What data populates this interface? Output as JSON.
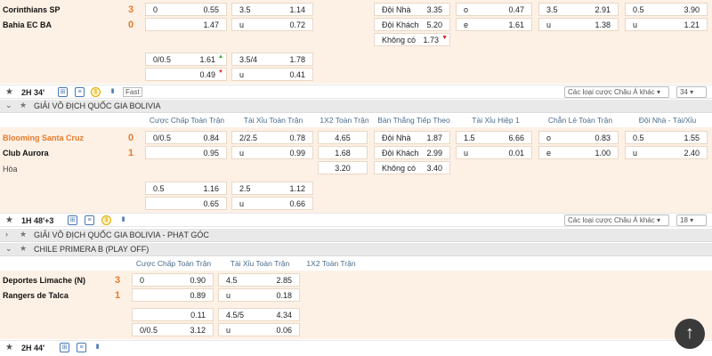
{
  "match1": {
    "home": "Corinthians SP",
    "home_score": "3",
    "away": "Bahia EC BA",
    "away_score": "0",
    "hcap": [
      {
        "line": "0",
        "home": "0.55",
        "ou_line": "3.5",
        "ou": "1.14"
      },
      {
        "line": "",
        "home": "1.47",
        "ou_line": "u",
        "ou": "0.72"
      }
    ],
    "extra": [
      {
        "line": "0/0.5",
        "home": "1.61",
        "ou_line": "3.5/4",
        "ou": "1.78"
      },
      {
        "line": "",
        "home": "0.49",
        "ou_line": "u",
        "ou": "0.41"
      }
    ],
    "next_goal": [
      {
        "label": "Đội Nhà",
        "val": "3.35"
      },
      {
        "label": "Đội Khách",
        "val": "5.20"
      },
      {
        "label": "Không có",
        "val": "1.73"
      }
    ],
    "oe": [
      {
        "l": "o",
        "v": "0.47"
      },
      {
        "l": "e",
        "v": "1.61"
      }
    ],
    "half_ou": [
      {
        "l": "3.5",
        "v": "2.91"
      },
      {
        "l": "u",
        "v": "1.38"
      }
    ],
    "home_ou": [
      {
        "l": "0.5",
        "v": "3.90"
      },
      {
        "l": "u",
        "v": "1.21"
      }
    ]
  },
  "bar1": {
    "time": "2H 34'",
    "fast": "Fast",
    "select": "Các loại cược Châu Á khác",
    "count": "34"
  },
  "league1": "GIẢI VÔ ĐỊCH QUỐC GIA BOLIVIA",
  "headers1": [
    "Cược Chấp Toàn Trận",
    "Tài Xỉu Toàn Trận",
    "1X2 Toàn Trận",
    "Bàn Thắng Tiếp Theo",
    "Tài Xỉu Hiệp 1",
    "Chẵn Lẻ Toàn Trận",
    "Đội Nhà - Tài/Xỉu"
  ],
  "match2": {
    "home": "Blooming Santa Cruz",
    "home_score": "0",
    "away": "Club Aurora",
    "away_score": "1",
    "draw": "Hòa",
    "hcap": [
      {
        "line": "0/0.5",
        "home": "0.84",
        "ou_line": "2/2.5",
        "ou": "0.78",
        "x12": "4.65"
      },
      {
        "line": "",
        "home": "0.95",
        "ou_line": "u",
        "ou": "0.99",
        "x12": "1.68"
      },
      {
        "x12": "3.20"
      }
    ],
    "extra": [
      {
        "line": "0.5",
        "home": "1.16",
        "ou_line": "2.5",
        "ou": "1.12"
      },
      {
        "line": "",
        "home": "0.65",
        "ou_line": "u",
        "ou": "0.66"
      }
    ],
    "next_goal": [
      {
        "label": "Đội Nhà",
        "val": "1.87"
      },
      {
        "label": "Đội Khách",
        "val": "2.99"
      },
      {
        "label": "Không có",
        "val": "3.40"
      }
    ],
    "half_ou": [
      {
        "l": "1.5",
        "v": "6.66"
      },
      {
        "l": "u",
        "v": "0.01"
      }
    ],
    "oe": [
      {
        "l": "o",
        "v": "0.83"
      },
      {
        "l": "e",
        "v": "1.00"
      }
    ],
    "home_ou": [
      {
        "l": "0.5",
        "v": "1.55"
      },
      {
        "l": "u",
        "v": "2.40"
      }
    ]
  },
  "bar2": {
    "time": "1H 48'+3",
    "select": "Các loại cược Châu Á khác",
    "count": "18"
  },
  "league2": "GIẢI VÔ ĐỊCH QUỐC GIA BOLIVIA - PHẠT GÓC",
  "league3": "CHILE PRIMERA B (PLAY OFF)",
  "headers3": [
    "Cược Chấp Toàn Trận",
    "Tài Xỉu Toàn Trận",
    "1X2 Toàn Trận"
  ],
  "match3": {
    "home": "Deportes Limache (N)",
    "home_score": "3",
    "away": "Rangers de Talca",
    "away_score": "1",
    "hcap": [
      {
        "line": "0",
        "home": "0.90",
        "ou_line": "4.5",
        "ou": "2.85"
      },
      {
        "line": "",
        "home": "0.89",
        "ou_line": "u",
        "ou": "0.18"
      }
    ],
    "extra": [
      {
        "line": "",
        "home": "0.11",
        "ou_line": "4.5/5",
        "ou": "4.34"
      },
      {
        "line": "0/0.5",
        "home": "3.12",
        "ou_line": "u",
        "ou": "0.06"
      }
    ]
  },
  "bar3": {
    "time": "2H 44'"
  },
  "colors": {
    "accent": "#e57a2a",
    "header_text": "#4a6b8a",
    "row_bg": "#fdf1e6"
  }
}
